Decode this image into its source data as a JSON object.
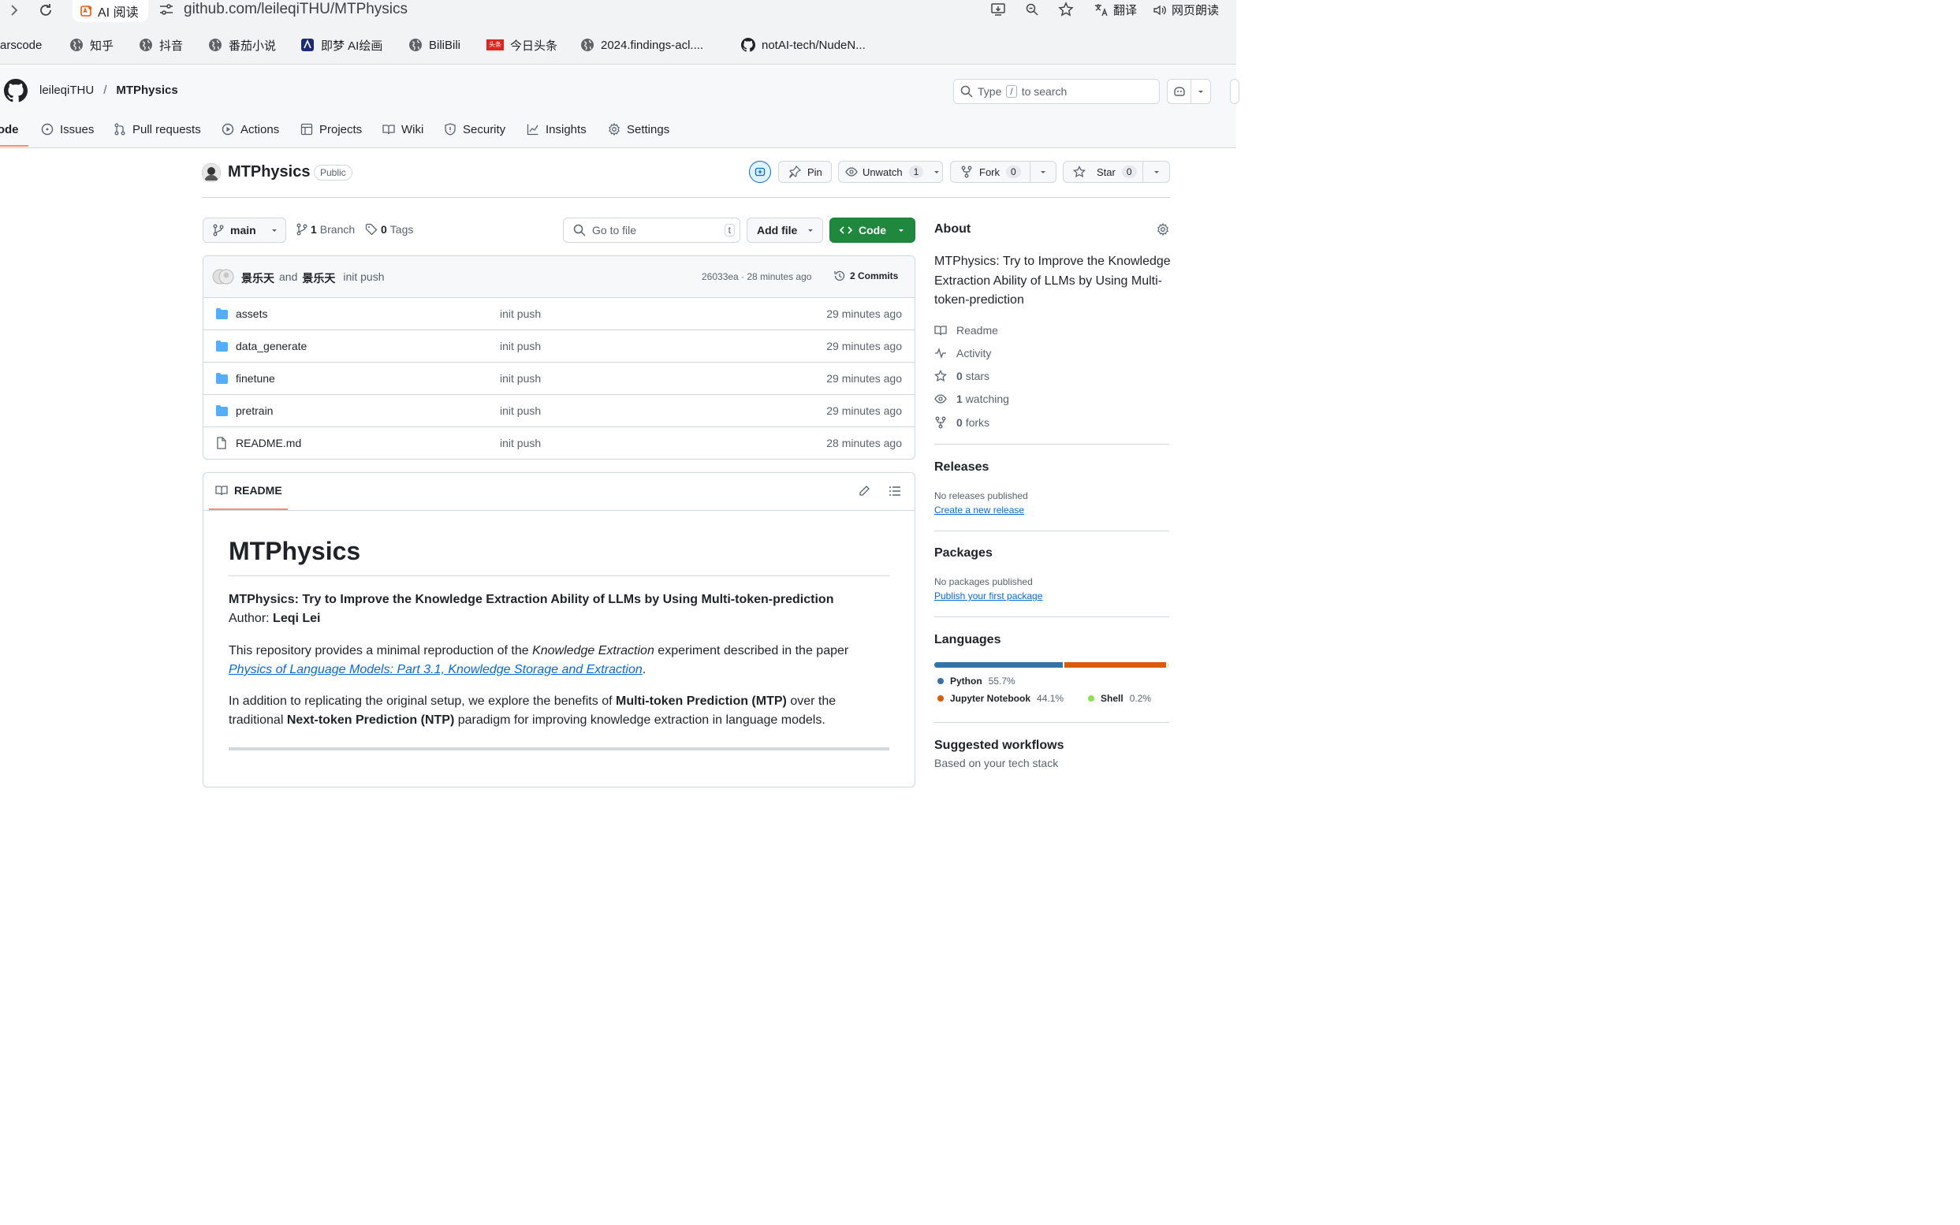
{
  "browser": {
    "ai_tab_label": "AI 阅读",
    "url": "github.com/leileqiTHU/MTPhysics",
    "translate_label": "翻译",
    "read_aloud_label": "网页朗读",
    "bookmarks": [
      "arscode",
      "知乎",
      "抖音",
      "番茄小说",
      "即梦 AI绘画",
      "BiliBili",
      "今日头条",
      "2024.findings-acl....",
      "notAI-tech/NudeN..."
    ],
    "toutiao_badge": "头条"
  },
  "header": {
    "owner": "leileqiTHU",
    "separator": "/",
    "repo": "MTPhysics",
    "search_prefix": "Type",
    "search_key": "/",
    "search_suffix": "to search"
  },
  "tabs": {
    "code": "Code",
    "issues": "Issues",
    "pull_requests": "Pull requests",
    "actions": "Actions",
    "projects": "Projects",
    "wiki": "Wiki",
    "security": "Security",
    "insights": "Insights",
    "settings": "Settings"
  },
  "repo": {
    "name": "MTPhysics",
    "visibility": "Public",
    "pin": "Pin",
    "unwatch": "Unwatch",
    "watch_count": "1",
    "fork": "Fork",
    "fork_count": "0",
    "star": "Star",
    "star_count": "0"
  },
  "toolbar": {
    "branch": "main",
    "branch_count": "1",
    "branch_label": "Branch",
    "tag_count": "0",
    "tag_label": "Tags",
    "go_to_file": "Go to file",
    "go_to_file_key": "t",
    "add_file": "Add file",
    "code": "Code"
  },
  "commit": {
    "author1": "景乐天",
    "and": "and",
    "author2": "景乐天",
    "message": "init push",
    "sha_time": "26033ea · 28 minutes ago",
    "commits": "2 Commits"
  },
  "files": [
    {
      "name": "assets",
      "type": "folder",
      "message": "init push",
      "age": "29 minutes ago"
    },
    {
      "name": "data_generate",
      "type": "folder",
      "message": "init push",
      "age": "29 minutes ago"
    },
    {
      "name": "finetune",
      "type": "folder",
      "message": "init push",
      "age": "29 minutes ago"
    },
    {
      "name": "pretrain",
      "type": "folder",
      "message": "init push",
      "age": "29 minutes ago"
    },
    {
      "name": "README.md",
      "type": "file",
      "message": "init push",
      "age": "28 minutes ago"
    }
  ],
  "readme": {
    "tab": "README",
    "title": "MTPhysics",
    "subtitle": "MTPhysics: Try to Improve the Knowledge Extraction Ability of LLMs by Using Multi-token-prediction",
    "author_label": "Author:",
    "author": "Leqi Lei",
    "p1_a": "This repository provides a minimal reproduction of the",
    "p1_em": "Knowledge Extraction",
    "p1_b": "experiment described in the paper",
    "p1_link": "Physics of Language Models: Part 3.1, Knowledge Storage and Extraction",
    "p1_end": ".",
    "p2_a": "In addition to replicating the original setup, we explore the benefits of",
    "p2_b1": "Multi-token Prediction (MTP)",
    "p2_c": "over the",
    "p2_d": "traditional",
    "p2_b2": "Next-token Prediction (NTP)",
    "p2_e": "paradigm for improving knowledge extraction in language models."
  },
  "about": {
    "title": "About",
    "description": "MTPhysics: Try to Improve the Knowledge Extraction Ability of LLMs by Using Multi-token-prediction",
    "readme": "Readme",
    "activity": "Activity",
    "stars_num": "0",
    "stars_label": "stars",
    "watching_num": "1",
    "watching_label": "watching",
    "forks_num": "0",
    "forks_label": "forks"
  },
  "releases": {
    "title": "Releases",
    "none": "No releases published",
    "link": "Create a new release"
  },
  "packages": {
    "title": "Packages",
    "none": "No packages published",
    "link": "Publish your first package"
  },
  "languages": {
    "title": "Languages",
    "items": [
      {
        "name": "Python",
        "percent": "55.7%",
        "value": 55.7,
        "color": "#3572A5"
      },
      {
        "name": "Jupyter Notebook",
        "percent": "44.1%",
        "value": 44.1,
        "color": "#DA5B0B"
      },
      {
        "name": "Shell",
        "percent": "0.2%",
        "value": 0.2,
        "color": "#89e051"
      }
    ]
  },
  "workflows": {
    "title": "Suggested workflows",
    "subtitle": "Based on your tech stack"
  }
}
